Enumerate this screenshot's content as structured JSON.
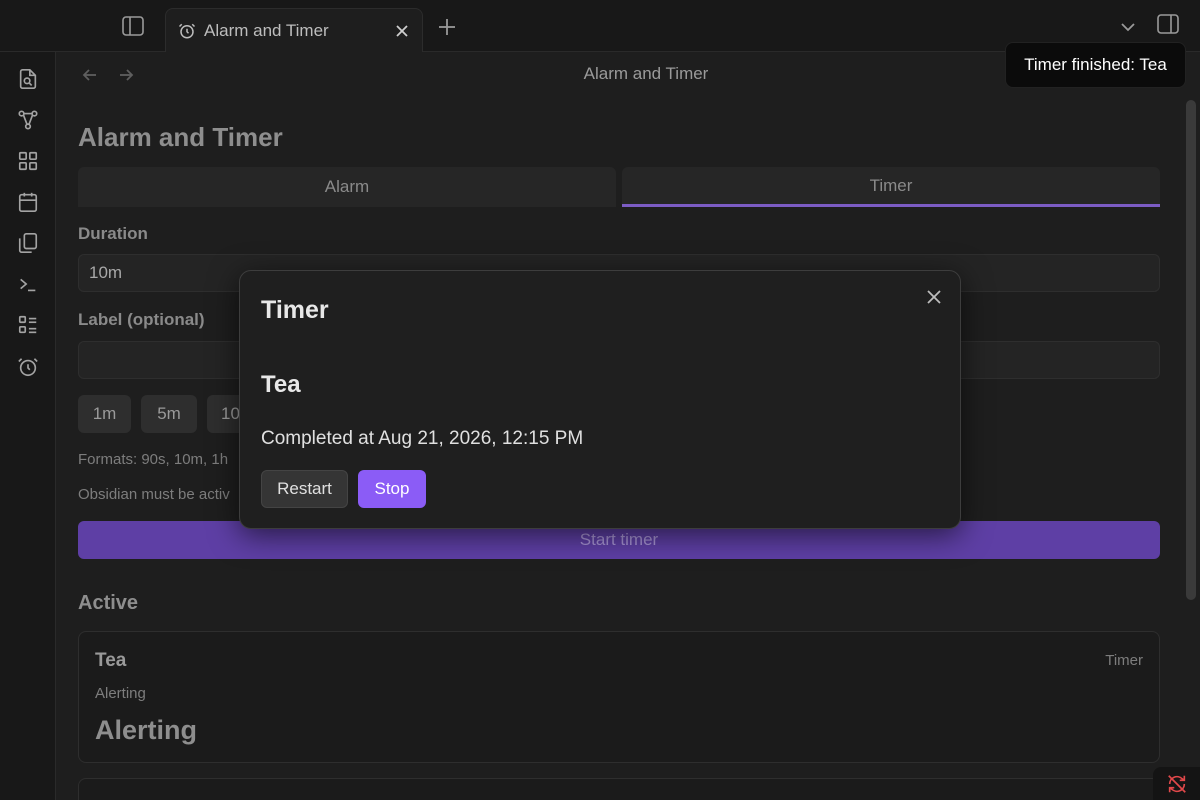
{
  "tab": {
    "title": "Alarm and Timer",
    "icon": "alarm-clock-icon"
  },
  "view": {
    "title": "Alarm and Timer"
  },
  "page": {
    "heading": "Alarm and Timer",
    "modes": [
      "Alarm",
      "Timer"
    ],
    "active_mode": "Timer",
    "duration_label": "Duration",
    "duration_value": "10m",
    "label_label": "Label (optional)",
    "label_value": "",
    "presets": [
      "1m",
      "5m",
      "10"
    ],
    "formats_hint": "Formats: 90s, 10m, 1h",
    "active_hint": "Obsidian must be activ",
    "start_button": "Start timer",
    "active_heading": "Active"
  },
  "active_items": [
    {
      "title": "Tea",
      "type": "Timer",
      "status": "Alerting",
      "big_status": "Alerting"
    }
  ],
  "notice": {
    "text": "Timer finished: Tea"
  },
  "modal": {
    "title": "Timer",
    "name": "Tea",
    "completed_text": "Completed at Aug 21, 2026, 12:15 PM",
    "restart_label": "Restart",
    "stop_label": "Stop"
  },
  "ribbon": {
    "icons": [
      "search-file-icon",
      "graph-icon",
      "grid-icon",
      "calendar-icon",
      "files-icon",
      "terminal-icon",
      "list-icon",
      "alarm-clock-icon"
    ]
  },
  "colors": {
    "accent": "#8b5cf6",
    "accent_dim": "#5e3fa5",
    "sync_error": "#e0484a"
  }
}
